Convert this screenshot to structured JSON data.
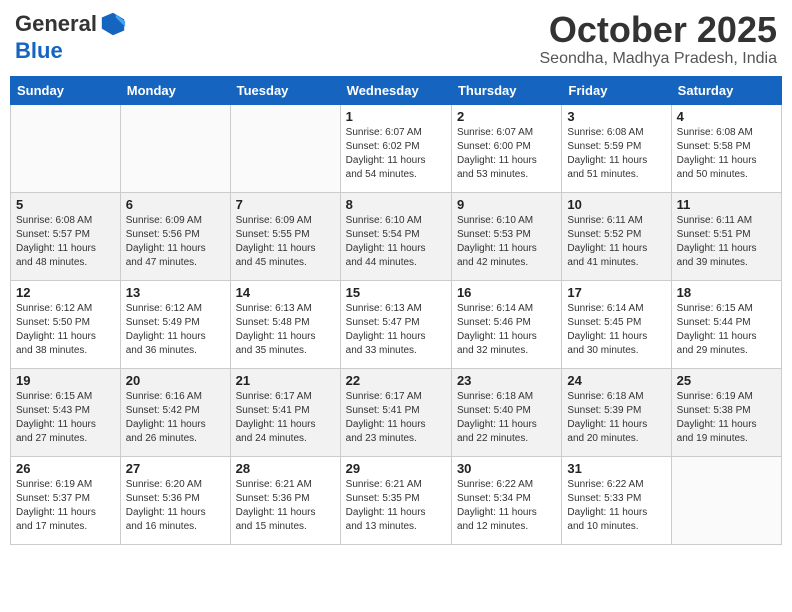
{
  "header": {
    "logo_general": "General",
    "logo_blue": "Blue",
    "month_title": "October 2025",
    "location": "Seondha, Madhya Pradesh, India"
  },
  "days_of_week": [
    "Sunday",
    "Monday",
    "Tuesday",
    "Wednesday",
    "Thursday",
    "Friday",
    "Saturday"
  ],
  "weeks": [
    [
      {
        "day": "",
        "info": ""
      },
      {
        "day": "",
        "info": ""
      },
      {
        "day": "",
        "info": ""
      },
      {
        "day": "1",
        "info": "Sunrise: 6:07 AM\nSunset: 6:02 PM\nDaylight: 11 hours\nand 54 minutes."
      },
      {
        "day": "2",
        "info": "Sunrise: 6:07 AM\nSunset: 6:00 PM\nDaylight: 11 hours\nand 53 minutes."
      },
      {
        "day": "3",
        "info": "Sunrise: 6:08 AM\nSunset: 5:59 PM\nDaylight: 11 hours\nand 51 minutes."
      },
      {
        "day": "4",
        "info": "Sunrise: 6:08 AM\nSunset: 5:58 PM\nDaylight: 11 hours\nand 50 minutes."
      }
    ],
    [
      {
        "day": "5",
        "info": "Sunrise: 6:08 AM\nSunset: 5:57 PM\nDaylight: 11 hours\nand 48 minutes."
      },
      {
        "day": "6",
        "info": "Sunrise: 6:09 AM\nSunset: 5:56 PM\nDaylight: 11 hours\nand 47 minutes."
      },
      {
        "day": "7",
        "info": "Sunrise: 6:09 AM\nSunset: 5:55 PM\nDaylight: 11 hours\nand 45 minutes."
      },
      {
        "day": "8",
        "info": "Sunrise: 6:10 AM\nSunset: 5:54 PM\nDaylight: 11 hours\nand 44 minutes."
      },
      {
        "day": "9",
        "info": "Sunrise: 6:10 AM\nSunset: 5:53 PM\nDaylight: 11 hours\nand 42 minutes."
      },
      {
        "day": "10",
        "info": "Sunrise: 6:11 AM\nSunset: 5:52 PM\nDaylight: 11 hours\nand 41 minutes."
      },
      {
        "day": "11",
        "info": "Sunrise: 6:11 AM\nSunset: 5:51 PM\nDaylight: 11 hours\nand 39 minutes."
      }
    ],
    [
      {
        "day": "12",
        "info": "Sunrise: 6:12 AM\nSunset: 5:50 PM\nDaylight: 11 hours\nand 38 minutes."
      },
      {
        "day": "13",
        "info": "Sunrise: 6:12 AM\nSunset: 5:49 PM\nDaylight: 11 hours\nand 36 minutes."
      },
      {
        "day": "14",
        "info": "Sunrise: 6:13 AM\nSunset: 5:48 PM\nDaylight: 11 hours\nand 35 minutes."
      },
      {
        "day": "15",
        "info": "Sunrise: 6:13 AM\nSunset: 5:47 PM\nDaylight: 11 hours\nand 33 minutes."
      },
      {
        "day": "16",
        "info": "Sunrise: 6:14 AM\nSunset: 5:46 PM\nDaylight: 11 hours\nand 32 minutes."
      },
      {
        "day": "17",
        "info": "Sunrise: 6:14 AM\nSunset: 5:45 PM\nDaylight: 11 hours\nand 30 minutes."
      },
      {
        "day": "18",
        "info": "Sunrise: 6:15 AM\nSunset: 5:44 PM\nDaylight: 11 hours\nand 29 minutes."
      }
    ],
    [
      {
        "day": "19",
        "info": "Sunrise: 6:15 AM\nSunset: 5:43 PM\nDaylight: 11 hours\nand 27 minutes."
      },
      {
        "day": "20",
        "info": "Sunrise: 6:16 AM\nSunset: 5:42 PM\nDaylight: 11 hours\nand 26 minutes."
      },
      {
        "day": "21",
        "info": "Sunrise: 6:17 AM\nSunset: 5:41 PM\nDaylight: 11 hours\nand 24 minutes."
      },
      {
        "day": "22",
        "info": "Sunrise: 6:17 AM\nSunset: 5:41 PM\nDaylight: 11 hours\nand 23 minutes."
      },
      {
        "day": "23",
        "info": "Sunrise: 6:18 AM\nSunset: 5:40 PM\nDaylight: 11 hours\nand 22 minutes."
      },
      {
        "day": "24",
        "info": "Sunrise: 6:18 AM\nSunset: 5:39 PM\nDaylight: 11 hours\nand 20 minutes."
      },
      {
        "day": "25",
        "info": "Sunrise: 6:19 AM\nSunset: 5:38 PM\nDaylight: 11 hours\nand 19 minutes."
      }
    ],
    [
      {
        "day": "26",
        "info": "Sunrise: 6:19 AM\nSunset: 5:37 PM\nDaylight: 11 hours\nand 17 minutes."
      },
      {
        "day": "27",
        "info": "Sunrise: 6:20 AM\nSunset: 5:36 PM\nDaylight: 11 hours\nand 16 minutes."
      },
      {
        "day": "28",
        "info": "Sunrise: 6:21 AM\nSunset: 5:36 PM\nDaylight: 11 hours\nand 15 minutes."
      },
      {
        "day": "29",
        "info": "Sunrise: 6:21 AM\nSunset: 5:35 PM\nDaylight: 11 hours\nand 13 minutes."
      },
      {
        "day": "30",
        "info": "Sunrise: 6:22 AM\nSunset: 5:34 PM\nDaylight: 11 hours\nand 12 minutes."
      },
      {
        "day": "31",
        "info": "Sunrise: 6:22 AM\nSunset: 5:33 PM\nDaylight: 11 hours\nand 10 minutes."
      },
      {
        "day": "",
        "info": ""
      }
    ]
  ]
}
